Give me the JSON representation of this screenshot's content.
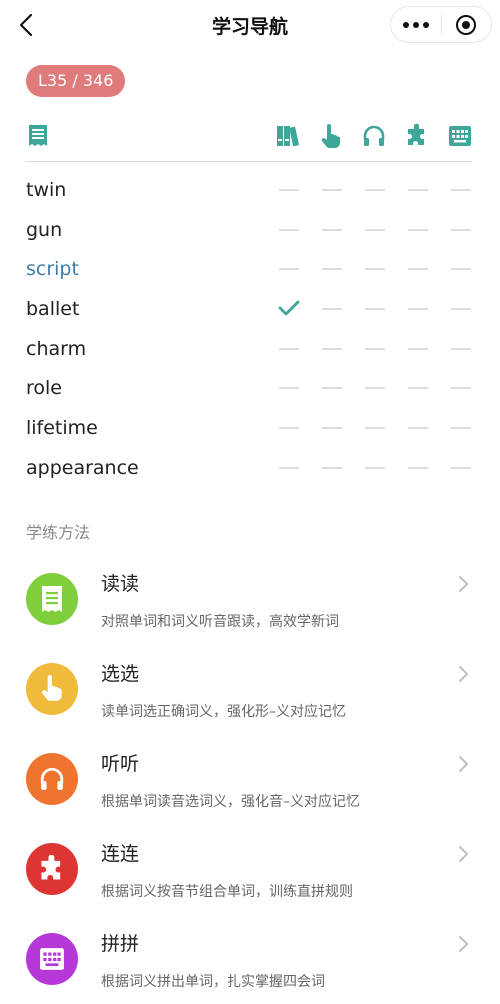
{
  "navbar": {
    "title": "学习导航"
  },
  "progress": {
    "text": "L35 / 346"
  },
  "header_icons": [
    "book-list-icon",
    "books-icon",
    "pointer-hand-icon",
    "headphones-icon",
    "puzzle-icon",
    "keyboard-icon"
  ],
  "words": [
    {
      "text": "twin",
      "highlight": false,
      "done": [
        false,
        false,
        false,
        false,
        false
      ]
    },
    {
      "text": "gun",
      "highlight": false,
      "done": [
        false,
        false,
        false,
        false,
        false
      ]
    },
    {
      "text": "script",
      "highlight": true,
      "done": [
        false,
        false,
        false,
        false,
        false
      ]
    },
    {
      "text": "ballet",
      "highlight": false,
      "done": [
        true,
        false,
        false,
        false,
        false
      ]
    },
    {
      "text": "charm",
      "highlight": false,
      "done": [
        false,
        false,
        false,
        false,
        false
      ]
    },
    {
      "text": "role",
      "highlight": false,
      "done": [
        false,
        false,
        false,
        false,
        false
      ]
    },
    {
      "text": "lifetime",
      "highlight": false,
      "done": [
        false,
        false,
        false,
        false,
        false
      ]
    },
    {
      "text": "appearance",
      "highlight": false,
      "done": [
        false,
        false,
        false,
        false,
        false
      ]
    }
  ],
  "methods_section": {
    "label": "学练方法"
  },
  "methods": [
    {
      "title": "读读",
      "desc": "对照单词和词义听音跟读，高效学新词",
      "color": "#7fcf3c",
      "icon": "document-icon"
    },
    {
      "title": "选选",
      "desc": "读单词选正确词义，强化形–义对应记忆",
      "color": "#f0bb3a",
      "icon": "pointer-hand-icon"
    },
    {
      "title": "听听",
      "desc": "根据单词读音选词义，强化音–义对应记忆",
      "color": "#ee7430",
      "icon": "headphones-icon"
    },
    {
      "title": "连连",
      "desc": "根据词义按音节组合单词，训练直拼规则",
      "color": "#dd3434",
      "icon": "puzzle-icon"
    },
    {
      "title": "拼拼",
      "desc": "根据词义拼出单词，扎实掌握四会词",
      "color": "#b638d8",
      "icon": "keyboard-icon"
    }
  ],
  "colors": {
    "accent": "#3fa69a",
    "badge": "#e07b7b",
    "highlight_word": "#3f7ea6"
  }
}
